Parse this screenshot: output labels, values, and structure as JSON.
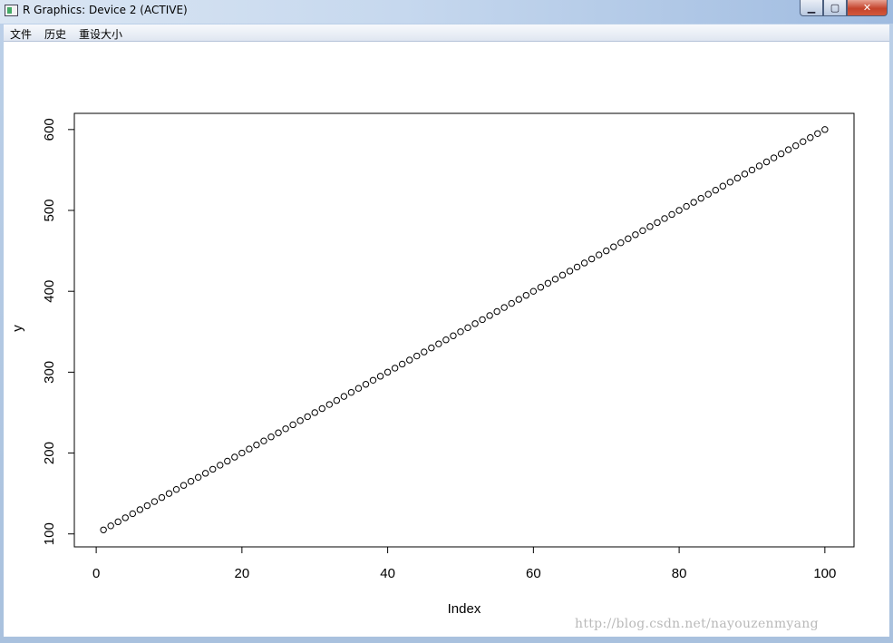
{
  "window": {
    "title": "R Graphics: Device 2 (ACTIVE)",
    "buttons": {
      "minimize_icon": "minimize-icon",
      "maximize_icon": "maximize-icon",
      "close_icon": "close-icon"
    }
  },
  "menu": {
    "items": [
      {
        "label": "文件"
      },
      {
        "label": "历史"
      },
      {
        "label": "重设大小"
      }
    ]
  },
  "watermark": "http://blog.csdn.net/nayouzenmyang",
  "chart_data": {
    "type": "scatter",
    "marker": "open-circle",
    "xlabel": "Index",
    "ylabel": "y",
    "xlim": [
      -3,
      104
    ],
    "ylim": [
      84,
      620
    ],
    "xticks": [
      0,
      20,
      40,
      60,
      80,
      100
    ],
    "yticks": [
      100,
      200,
      300,
      400,
      500,
      600
    ],
    "x_start": 1,
    "x_end": 100,
    "y_formula": "y = 5*Index + 100",
    "series": [
      {
        "name": "",
        "x": [
          1,
          2,
          3,
          4,
          5,
          6,
          7,
          8,
          9,
          10,
          11,
          12,
          13,
          14,
          15,
          16,
          17,
          18,
          19,
          20,
          21,
          22,
          23,
          24,
          25,
          26,
          27,
          28,
          29,
          30,
          31,
          32,
          33,
          34,
          35,
          36,
          37,
          38,
          39,
          40,
          41,
          42,
          43,
          44,
          45,
          46,
          47,
          48,
          49,
          50,
          51,
          52,
          53,
          54,
          55,
          56,
          57,
          58,
          59,
          60,
          61,
          62,
          63,
          64,
          65,
          66,
          67,
          68,
          69,
          70,
          71,
          72,
          73,
          74,
          75,
          76,
          77,
          78,
          79,
          80,
          81,
          82,
          83,
          84,
          85,
          86,
          87,
          88,
          89,
          90,
          91,
          92,
          93,
          94,
          95,
          96,
          97,
          98,
          99,
          100
        ],
        "y": [
          105,
          110,
          115,
          120,
          125,
          130,
          135,
          140,
          145,
          150,
          155,
          160,
          165,
          170,
          175,
          180,
          185,
          190,
          195,
          200,
          205,
          210,
          215,
          220,
          225,
          230,
          235,
          240,
          245,
          250,
          255,
          260,
          265,
          270,
          275,
          280,
          285,
          290,
          295,
          300,
          305,
          310,
          315,
          320,
          325,
          330,
          335,
          340,
          345,
          350,
          355,
          360,
          365,
          370,
          375,
          380,
          385,
          390,
          395,
          400,
          405,
          410,
          415,
          420,
          425,
          430,
          435,
          440,
          445,
          450,
          455,
          460,
          465,
          470,
          475,
          480,
          485,
          490,
          495,
          500,
          505,
          510,
          515,
          520,
          525,
          530,
          535,
          540,
          545,
          550,
          555,
          560,
          565,
          570,
          575,
          580,
          585,
          590,
          595,
          600
        ]
      }
    ],
    "grid": false,
    "legend": "none"
  }
}
